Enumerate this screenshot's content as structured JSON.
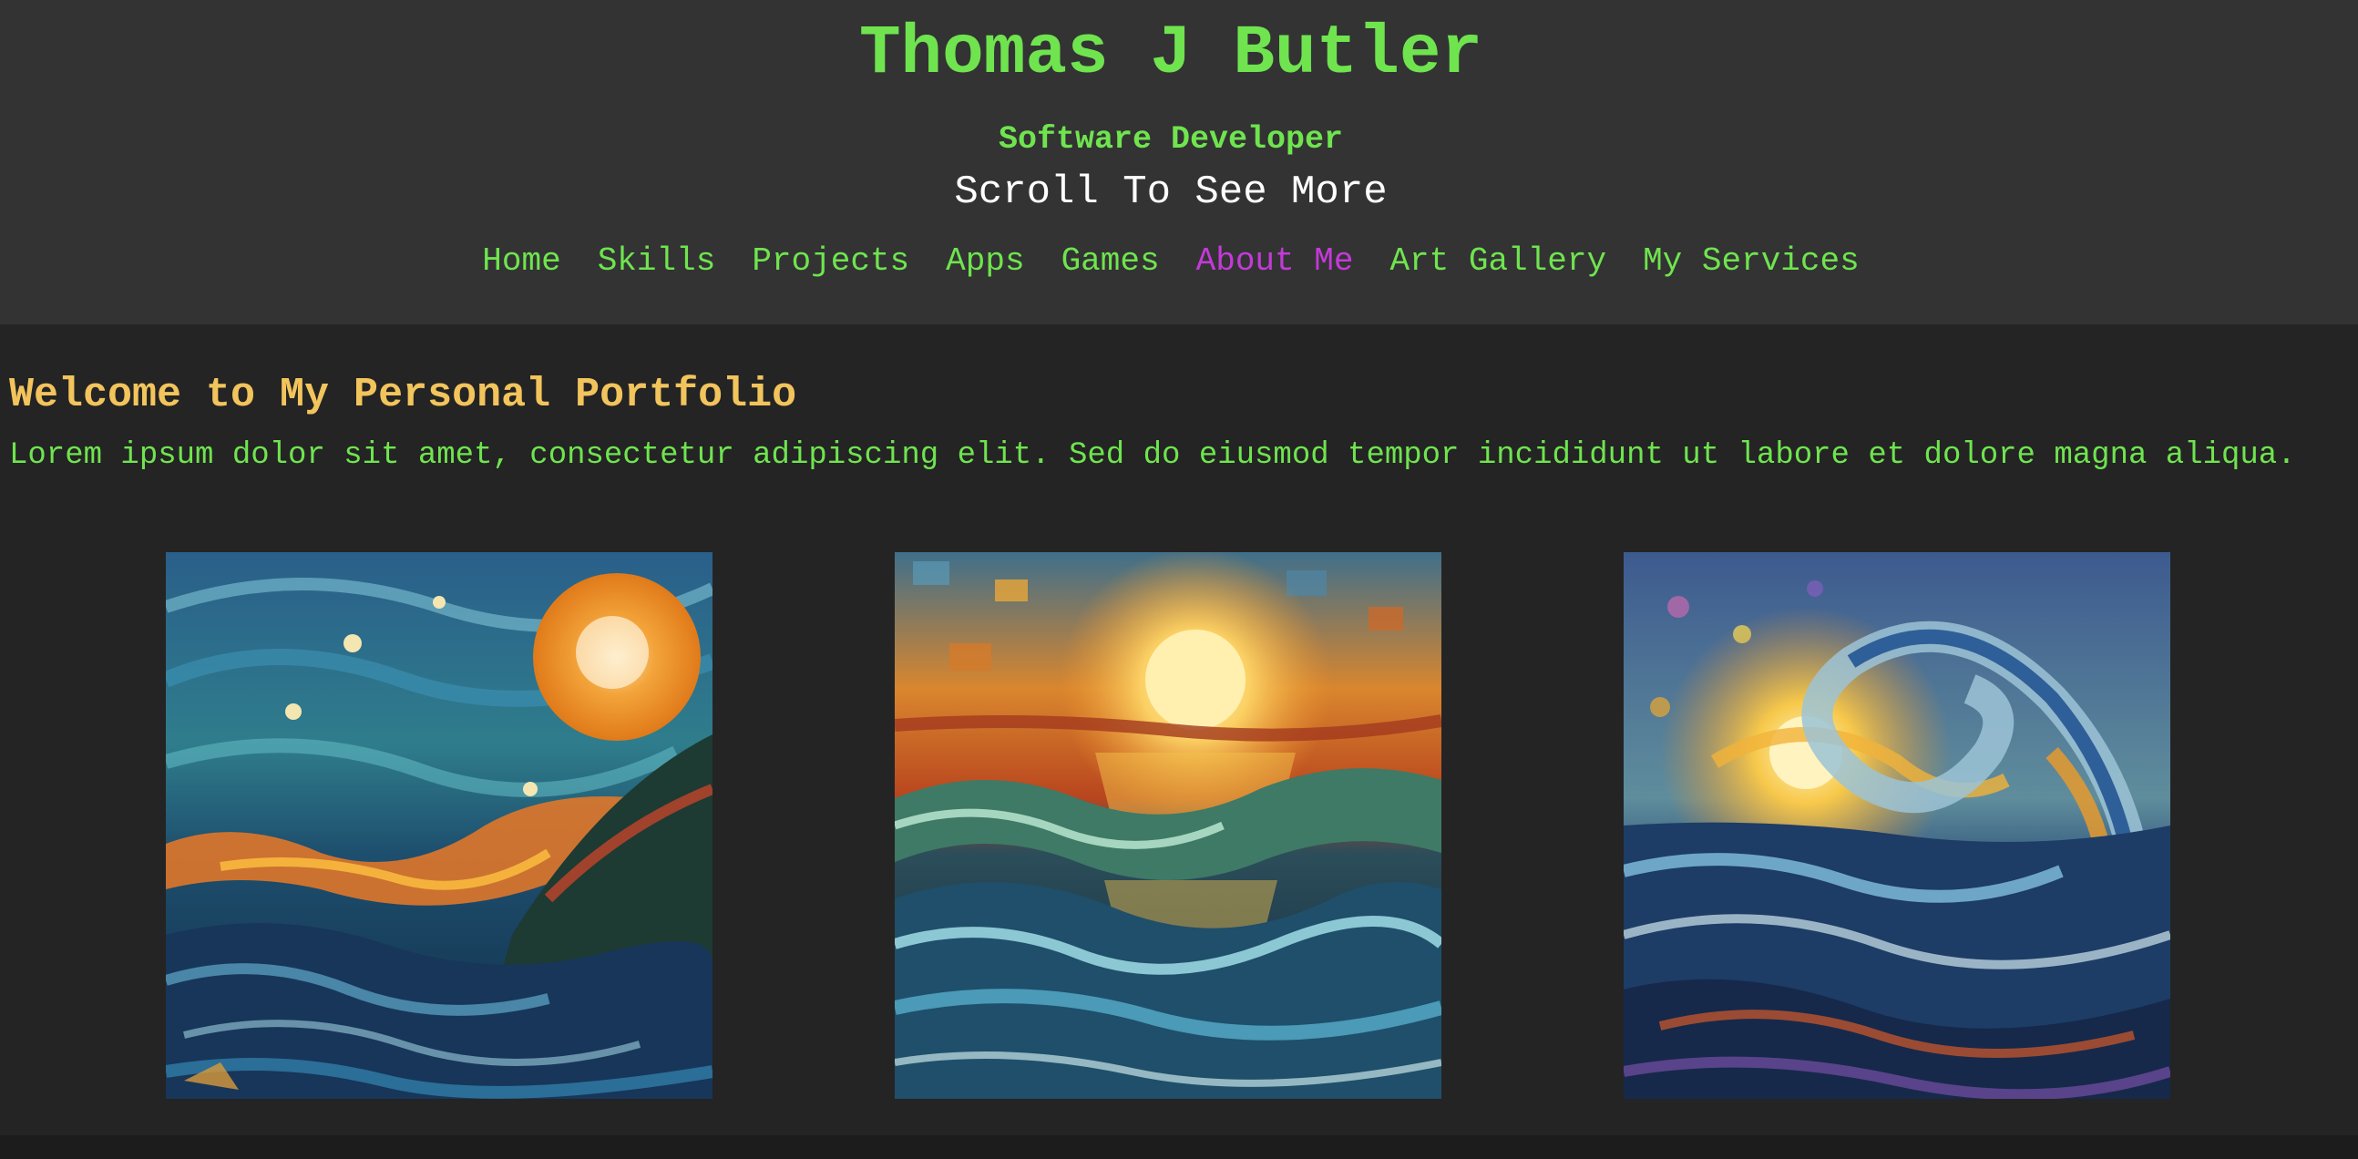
{
  "header": {
    "title": "Thomas J Butler",
    "subtitle": "Software Developer",
    "scroll_hint": "Scroll To See More"
  },
  "nav": {
    "items": [
      {
        "label": "Home",
        "active": false
      },
      {
        "label": "Skills",
        "active": false
      },
      {
        "label": "Projects",
        "active": false
      },
      {
        "label": "Apps",
        "active": false
      },
      {
        "label": "Games",
        "active": false
      },
      {
        "label": "About Me",
        "active": true
      },
      {
        "label": "Art Gallery",
        "active": false
      },
      {
        "label": "My Services",
        "active": false
      }
    ]
  },
  "main": {
    "heading": "Welcome to My Personal Portfolio",
    "intro": "Lorem ipsum dolor sit amet, consectetur adipiscing elit. Sed do eiusmod tempor incididunt ut labore et dolore magna aliqua."
  },
  "colors": {
    "page_bg": "#242424",
    "header_bg": "#333333",
    "accent_green": "#6fe44f",
    "heading_gold": "#f2c45c",
    "nav_active": "#c33ad8"
  },
  "gallery": {
    "images": [
      {
        "name": "night-sea-moon-painting"
      },
      {
        "name": "sunset-waves-painting"
      },
      {
        "name": "swirling-wave-sun-painting"
      }
    ]
  }
}
